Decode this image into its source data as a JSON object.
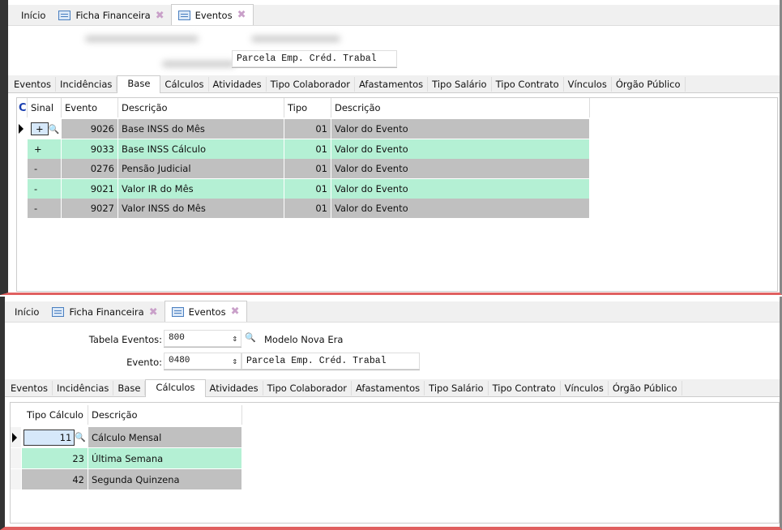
{
  "window_tabs": [
    {
      "label": "Início"
    },
    {
      "label": "Ficha Financeira"
    },
    {
      "label": "Eventos"
    }
  ],
  "subtabs": [
    "Eventos",
    "Incidências",
    "Base",
    "Cálculos",
    "Atividades",
    "Tipo Colaborador",
    "Afastamentos",
    "Tipo Salário",
    "Tipo Contrato",
    "Vínculos",
    "Órgão Público"
  ],
  "top": {
    "evento_desc": "Parcela Emp. Créd. Trabal",
    "active_subtab": "Base",
    "columns": [
      "C",
      "Sinal",
      "Evento",
      "Descrição",
      "Tipo",
      "Descrição"
    ],
    "rows": [
      {
        "sinal": "+",
        "evento": "9026",
        "descricao": "Base INSS do Mês",
        "tipo": "01",
        "tipo_desc": "Valor do Evento"
      },
      {
        "sinal": "+",
        "evento": "9033",
        "descricao": "Base INSS Cálculo",
        "tipo": "01",
        "tipo_desc": "Valor do Evento"
      },
      {
        "sinal": "-",
        "evento": "0276",
        "descricao": "Pensão Judicial",
        "tipo": "01",
        "tipo_desc": "Valor do Evento"
      },
      {
        "sinal": "-",
        "evento": "9021",
        "descricao": "Valor IR do Mês",
        "tipo": "01",
        "tipo_desc": "Valor do Evento"
      },
      {
        "sinal": "-",
        "evento": "9027",
        "descricao": "Valor INSS do Mês",
        "tipo": "01",
        "tipo_desc": "Valor do Evento"
      }
    ]
  },
  "bottom": {
    "tabela_label": "Tabela Eventos:",
    "tabela_value": "800",
    "tabela_desc": "Modelo Nova Era",
    "evento_label": "Evento:",
    "evento_value": "0480",
    "evento_desc": "Parcela Emp. Créd. Trabal",
    "active_subtab": "Cálculos",
    "columns": [
      "Tipo Cálculo",
      "Descrição"
    ],
    "rows": [
      {
        "tipo": "11",
        "descricao": "Cálculo Mensal"
      },
      {
        "tipo": "23",
        "descricao": "Última Semana"
      },
      {
        "tipo": "42",
        "descricao": "Segunda Quinzena"
      }
    ]
  },
  "colors": {
    "gray_row": "#c0c0c0",
    "green_row": "#b4f0d4",
    "accent_red": "#e06060"
  }
}
